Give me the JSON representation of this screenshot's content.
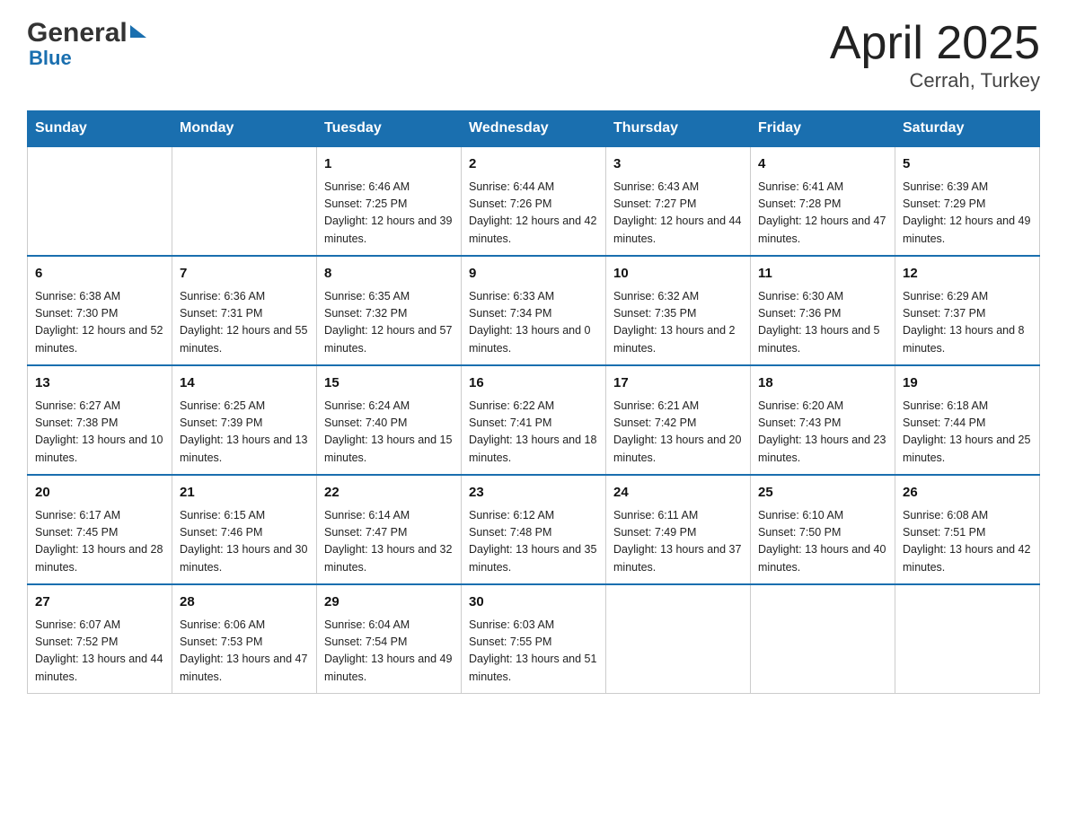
{
  "header": {
    "logo_general": "General",
    "logo_blue": "Blue",
    "title": "April 2025",
    "subtitle": "Cerrah, Turkey"
  },
  "days_of_week": [
    "Sunday",
    "Monday",
    "Tuesday",
    "Wednesday",
    "Thursday",
    "Friday",
    "Saturday"
  ],
  "weeks": [
    [
      {
        "day": "",
        "sunrise": "",
        "sunset": "",
        "daylight": ""
      },
      {
        "day": "",
        "sunrise": "",
        "sunset": "",
        "daylight": ""
      },
      {
        "day": "1",
        "sunrise": "Sunrise: 6:46 AM",
        "sunset": "Sunset: 7:25 PM",
        "daylight": "Daylight: 12 hours and 39 minutes."
      },
      {
        "day": "2",
        "sunrise": "Sunrise: 6:44 AM",
        "sunset": "Sunset: 7:26 PM",
        "daylight": "Daylight: 12 hours and 42 minutes."
      },
      {
        "day": "3",
        "sunrise": "Sunrise: 6:43 AM",
        "sunset": "Sunset: 7:27 PM",
        "daylight": "Daylight: 12 hours and 44 minutes."
      },
      {
        "day": "4",
        "sunrise": "Sunrise: 6:41 AM",
        "sunset": "Sunset: 7:28 PM",
        "daylight": "Daylight: 12 hours and 47 minutes."
      },
      {
        "day": "5",
        "sunrise": "Sunrise: 6:39 AM",
        "sunset": "Sunset: 7:29 PM",
        "daylight": "Daylight: 12 hours and 49 minutes."
      }
    ],
    [
      {
        "day": "6",
        "sunrise": "Sunrise: 6:38 AM",
        "sunset": "Sunset: 7:30 PM",
        "daylight": "Daylight: 12 hours and 52 minutes."
      },
      {
        "day": "7",
        "sunrise": "Sunrise: 6:36 AM",
        "sunset": "Sunset: 7:31 PM",
        "daylight": "Daylight: 12 hours and 55 minutes."
      },
      {
        "day": "8",
        "sunrise": "Sunrise: 6:35 AM",
        "sunset": "Sunset: 7:32 PM",
        "daylight": "Daylight: 12 hours and 57 minutes."
      },
      {
        "day": "9",
        "sunrise": "Sunrise: 6:33 AM",
        "sunset": "Sunset: 7:34 PM",
        "daylight": "Daylight: 13 hours and 0 minutes."
      },
      {
        "day": "10",
        "sunrise": "Sunrise: 6:32 AM",
        "sunset": "Sunset: 7:35 PM",
        "daylight": "Daylight: 13 hours and 2 minutes."
      },
      {
        "day": "11",
        "sunrise": "Sunrise: 6:30 AM",
        "sunset": "Sunset: 7:36 PM",
        "daylight": "Daylight: 13 hours and 5 minutes."
      },
      {
        "day": "12",
        "sunrise": "Sunrise: 6:29 AM",
        "sunset": "Sunset: 7:37 PM",
        "daylight": "Daylight: 13 hours and 8 minutes."
      }
    ],
    [
      {
        "day": "13",
        "sunrise": "Sunrise: 6:27 AM",
        "sunset": "Sunset: 7:38 PM",
        "daylight": "Daylight: 13 hours and 10 minutes."
      },
      {
        "day": "14",
        "sunrise": "Sunrise: 6:25 AM",
        "sunset": "Sunset: 7:39 PM",
        "daylight": "Daylight: 13 hours and 13 minutes."
      },
      {
        "day": "15",
        "sunrise": "Sunrise: 6:24 AM",
        "sunset": "Sunset: 7:40 PM",
        "daylight": "Daylight: 13 hours and 15 minutes."
      },
      {
        "day": "16",
        "sunrise": "Sunrise: 6:22 AM",
        "sunset": "Sunset: 7:41 PM",
        "daylight": "Daylight: 13 hours and 18 minutes."
      },
      {
        "day": "17",
        "sunrise": "Sunrise: 6:21 AM",
        "sunset": "Sunset: 7:42 PM",
        "daylight": "Daylight: 13 hours and 20 minutes."
      },
      {
        "day": "18",
        "sunrise": "Sunrise: 6:20 AM",
        "sunset": "Sunset: 7:43 PM",
        "daylight": "Daylight: 13 hours and 23 minutes."
      },
      {
        "day": "19",
        "sunrise": "Sunrise: 6:18 AM",
        "sunset": "Sunset: 7:44 PM",
        "daylight": "Daylight: 13 hours and 25 minutes."
      }
    ],
    [
      {
        "day": "20",
        "sunrise": "Sunrise: 6:17 AM",
        "sunset": "Sunset: 7:45 PM",
        "daylight": "Daylight: 13 hours and 28 minutes."
      },
      {
        "day": "21",
        "sunrise": "Sunrise: 6:15 AM",
        "sunset": "Sunset: 7:46 PM",
        "daylight": "Daylight: 13 hours and 30 minutes."
      },
      {
        "day": "22",
        "sunrise": "Sunrise: 6:14 AM",
        "sunset": "Sunset: 7:47 PM",
        "daylight": "Daylight: 13 hours and 32 minutes."
      },
      {
        "day": "23",
        "sunrise": "Sunrise: 6:12 AM",
        "sunset": "Sunset: 7:48 PM",
        "daylight": "Daylight: 13 hours and 35 minutes."
      },
      {
        "day": "24",
        "sunrise": "Sunrise: 6:11 AM",
        "sunset": "Sunset: 7:49 PM",
        "daylight": "Daylight: 13 hours and 37 minutes."
      },
      {
        "day": "25",
        "sunrise": "Sunrise: 6:10 AM",
        "sunset": "Sunset: 7:50 PM",
        "daylight": "Daylight: 13 hours and 40 minutes."
      },
      {
        "day": "26",
        "sunrise": "Sunrise: 6:08 AM",
        "sunset": "Sunset: 7:51 PM",
        "daylight": "Daylight: 13 hours and 42 minutes."
      }
    ],
    [
      {
        "day": "27",
        "sunrise": "Sunrise: 6:07 AM",
        "sunset": "Sunset: 7:52 PM",
        "daylight": "Daylight: 13 hours and 44 minutes."
      },
      {
        "day": "28",
        "sunrise": "Sunrise: 6:06 AM",
        "sunset": "Sunset: 7:53 PM",
        "daylight": "Daylight: 13 hours and 47 minutes."
      },
      {
        "day": "29",
        "sunrise": "Sunrise: 6:04 AM",
        "sunset": "Sunset: 7:54 PM",
        "daylight": "Daylight: 13 hours and 49 minutes."
      },
      {
        "day": "30",
        "sunrise": "Sunrise: 6:03 AM",
        "sunset": "Sunset: 7:55 PM",
        "daylight": "Daylight: 13 hours and 51 minutes."
      },
      {
        "day": "",
        "sunrise": "",
        "sunset": "",
        "daylight": ""
      },
      {
        "day": "",
        "sunrise": "",
        "sunset": "",
        "daylight": ""
      },
      {
        "day": "",
        "sunrise": "",
        "sunset": "",
        "daylight": ""
      }
    ]
  ]
}
